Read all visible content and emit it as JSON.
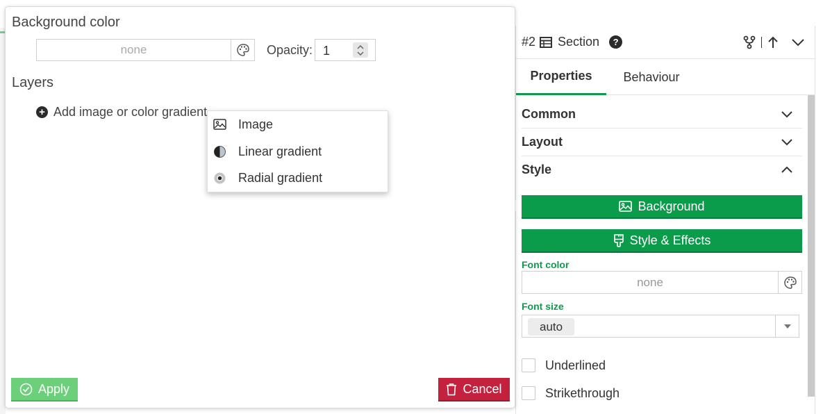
{
  "background_popup": {
    "bg_color_title": "Background color",
    "bg_color_value": "none",
    "opacity_label": "Opacity:",
    "opacity_value": "1",
    "layers_title": "Layers",
    "add_layer_label": "Add image or color gradient",
    "menu_items": [
      {
        "label": "Image",
        "icon": "image-icon"
      },
      {
        "label": "Linear gradient",
        "icon": "half-circle-icon"
      },
      {
        "label": "Radial gradient",
        "icon": "radial-circle-icon"
      }
    ],
    "apply_label": "Apply",
    "cancel_label": "Cancel"
  },
  "properties_panel": {
    "element_number": "#2",
    "element_type": "Section",
    "help_label": "?",
    "tabs": [
      {
        "label": "Properties",
        "active": true
      },
      {
        "label": "Behaviour",
        "active": false
      }
    ],
    "sections": [
      {
        "label": "Common",
        "expanded": false
      },
      {
        "label": "Layout",
        "expanded": false
      },
      {
        "label": "Style",
        "expanded": true
      }
    ],
    "background_button": "Background",
    "style_effects_button": "Style & Effects",
    "font_color_label": "Font color",
    "font_color_value": "none",
    "font_size_label": "Font size",
    "font_size_value": "auto",
    "checkboxes": [
      {
        "label": "Underlined",
        "checked": false
      },
      {
        "label": "Strikethrough",
        "checked": false
      }
    ]
  },
  "colors": {
    "accent_green": "#0a9b4b",
    "apply_green": "#6ccf7a",
    "cancel_red": "#c3213d"
  }
}
